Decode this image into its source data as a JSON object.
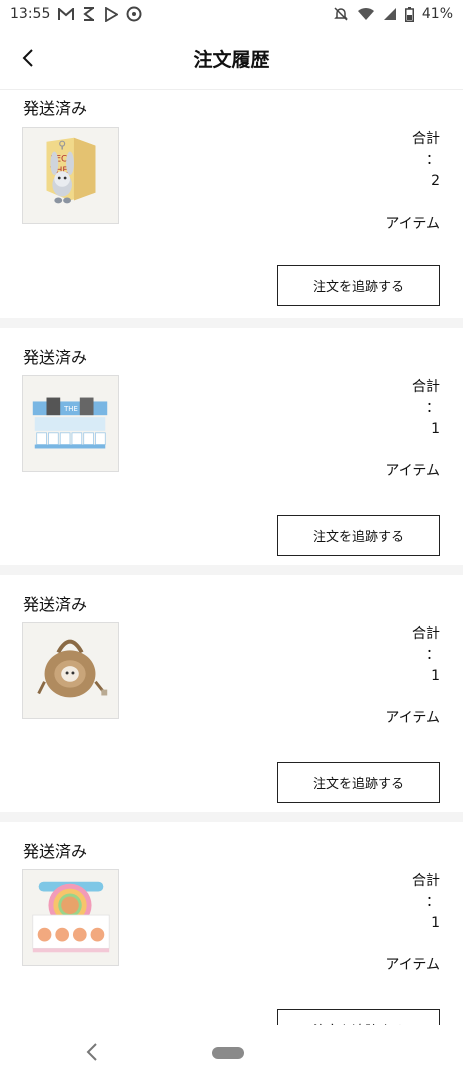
{
  "status_bar": {
    "time": "13:55",
    "battery": "41%",
    "left_icons": [
      "gmail-icon",
      "s-app-icon",
      "play-store-icon",
      "assistant-icon"
    ],
    "right_icons": [
      "mute-icon",
      "wifi-icon",
      "signal-icon",
      "battery-icon"
    ]
  },
  "header": {
    "title": "注文履歴",
    "back_icon": "chevron-left-icon"
  },
  "orders": [
    {
      "status": "発送済み",
      "total_label": "合計",
      "colon": "：",
      "count": "2",
      "unit": "アイテム",
      "button": "注文を追跡する",
      "thumb": "keychain-blind-box"
    },
    {
      "status": "発送済み",
      "total_label": "合計",
      "colon": "：",
      "count": "1",
      "unit": "アイテム",
      "button": "注文を追跡する",
      "thumb": "blind-box-display"
    },
    {
      "status": "発送済み",
      "total_label": "合計",
      "colon": "：",
      "count": "1",
      "unit": "アイテム",
      "button": "注文を追跡する",
      "thumb": "plush-bag"
    },
    {
      "status": "発送済み",
      "total_label": "合計",
      "colon": "：",
      "count": "1",
      "unit": "アイテム",
      "button": "注文を追跡する",
      "thumb": "rainbow-blind-box-set"
    }
  ],
  "nav": {
    "back_icon": "nav-back-icon",
    "home_icon": "home-pill-icon"
  }
}
